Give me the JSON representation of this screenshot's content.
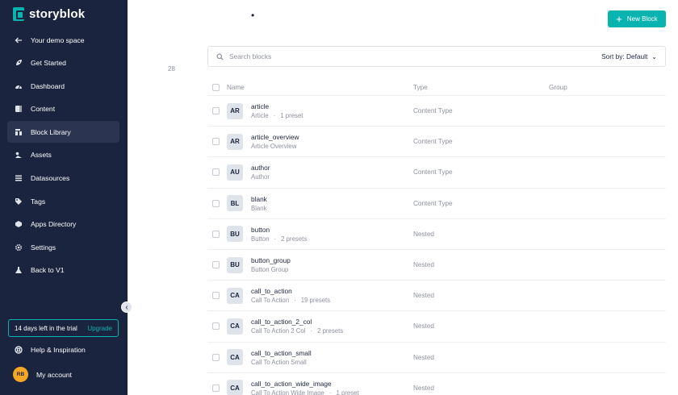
{
  "sidebar": {
    "brand": "storyblok",
    "items": [
      {
        "label": "Your demo space",
        "icon": "arrow-left-icon"
      },
      {
        "label": "Get Started",
        "icon": "rocket-icon"
      },
      {
        "label": "Dashboard",
        "icon": "gauge-icon"
      },
      {
        "label": "Content",
        "icon": "content-icon"
      },
      {
        "label": "Block Library",
        "icon": "blocks-icon",
        "active": true
      },
      {
        "label": "Assets",
        "icon": "assets-icon"
      },
      {
        "label": "Datasources",
        "icon": "datasources-icon"
      },
      {
        "label": "Tags",
        "icon": "tag-icon"
      },
      {
        "label": "Apps Directory",
        "icon": "apps-icon"
      },
      {
        "label": "Settings",
        "icon": "gear-icon"
      },
      {
        "label": "Back to V1",
        "icon": "flask-icon"
      }
    ],
    "collapse_icon": "chevron-left-icon",
    "trial": {
      "text": "14 days left in the trial",
      "upgrade": "Upgrade"
    },
    "help": "Help & Inspiration",
    "account": {
      "label": "My account",
      "initials": "RB"
    }
  },
  "main": {
    "top_glyph": "•",
    "new_block": "New Block",
    "count": "28",
    "search": {
      "placeholder": "Search blocks",
      "value": ""
    },
    "sort": "Sort by: Default",
    "columns": {
      "name": "Name",
      "type": "Type",
      "group": "Group"
    },
    "rows": [
      {
        "badge": "AR",
        "tech": "article",
        "display": "Article",
        "presets": "1 preset",
        "type": "Content Type"
      },
      {
        "badge": "AR",
        "tech": "article_overview",
        "display": "Article Overview",
        "presets": "",
        "type": "Content Type"
      },
      {
        "badge": "AU",
        "tech": "author",
        "display": "Author",
        "presets": "",
        "type": "Content Type"
      },
      {
        "badge": "BL",
        "tech": "blank",
        "display": "Blank",
        "presets": "",
        "type": "Content Type"
      },
      {
        "badge": "BU",
        "tech": "button",
        "display": "Button",
        "presets": "2 presets",
        "type": "Nested"
      },
      {
        "badge": "BU",
        "tech": "button_group",
        "display": "Button Group",
        "presets": "",
        "type": "Nested"
      },
      {
        "badge": "CA",
        "tech": "call_to_action",
        "display": "Call To Action",
        "presets": "19 presets",
        "type": "Nested"
      },
      {
        "badge": "CA",
        "tech": "call_to_action_2_col",
        "display": "Call To Action 2 Col",
        "presets": "2 presets",
        "type": "Nested"
      },
      {
        "badge": "CA",
        "tech": "call_to_action_small",
        "display": "Call To Action Small",
        "presets": "",
        "type": "Nested"
      },
      {
        "badge": "CA",
        "tech": "call_to_action_wide_image",
        "display": "Call To Action Wide Image",
        "presets": "1 preset",
        "type": "Nested"
      }
    ]
  },
  "colors": {
    "sidebar": "#1b243f",
    "accent": "#09b3af",
    "muted": "#8d919e"
  }
}
